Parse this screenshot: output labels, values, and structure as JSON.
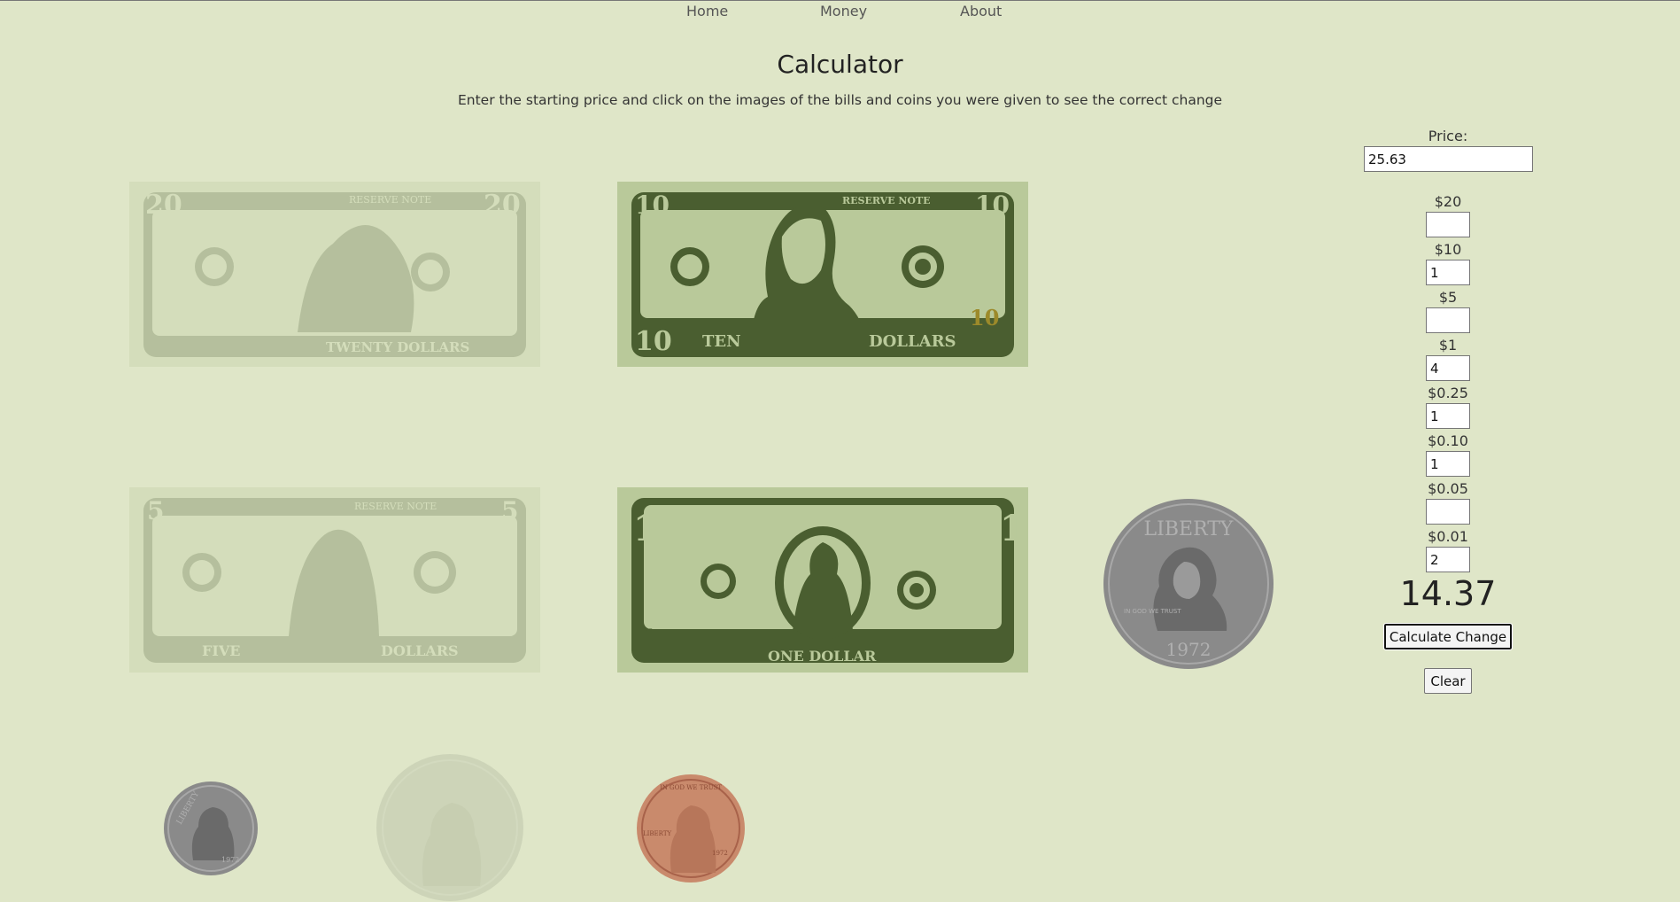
{
  "nav": {
    "home": "Home",
    "money": "Money",
    "about": "About"
  },
  "page": {
    "title": "Calculator",
    "subtitle": "Enter the starting price and click on the images of the bills and coins you were given to see the correct change"
  },
  "bills": {
    "twenty": {
      "corner": "20",
      "top": "RESERVE     NOTE",
      "bottom": "TWENTY DOLLARS"
    },
    "ten": {
      "corner": "10",
      "top": "RESERVE     NOTE",
      "left_word": "TEN",
      "right_word": "DOLLARS"
    },
    "five": {
      "corner": "5",
      "top": "RESERVE     NOTE",
      "left_word": "FIVE",
      "right_word": "DOLLARS"
    },
    "one": {
      "corner": "1",
      "bottom": "ONE DOLLAR"
    }
  },
  "coins": {
    "quarter": {
      "top": "LIBERTY",
      "year": "1972",
      "motto": "IN GOD WE TRUST"
    },
    "dime": {
      "top": "LIBERTY",
      "year": "1972"
    },
    "penny": {
      "top": "IN GOD WE TRUST",
      "left": "LIBERTY",
      "year": "1972"
    }
  },
  "calculator": {
    "price_label": "Price:",
    "price_value": "25.63",
    "denominations": [
      {
        "label": "$20",
        "value": ""
      },
      {
        "label": "$10",
        "value": "1"
      },
      {
        "label": "$5",
        "value": ""
      },
      {
        "label": "$1",
        "value": "4"
      },
      {
        "label": "$0.25",
        "value": "1"
      },
      {
        "label": "$0.10",
        "value": "1"
      },
      {
        "label": "$0.05",
        "value": ""
      },
      {
        "label": "$0.01",
        "value": "2"
      }
    ],
    "result": "14.37",
    "calculate_label": "Calculate Change",
    "clear_label": "Clear"
  },
  "colors": {
    "background": "#dfe6c8",
    "bill_dark": "#4a5e30",
    "bill_light": "#b9c99a",
    "coin_silver": "#8a8a8a",
    "coin_copper": "#c98a6c"
  }
}
